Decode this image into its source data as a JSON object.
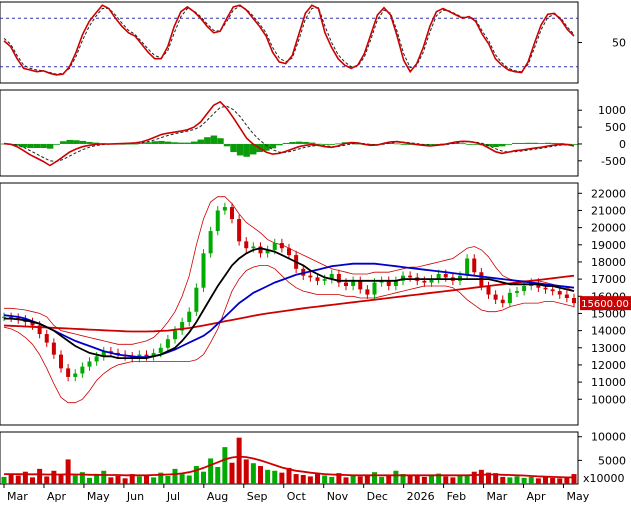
{
  "chart_data": [
    {
      "type": "line",
      "panel": "oscillator",
      "y_ticks": [
        {
          "value": 50,
          "label": "50"
        }
      ],
      "ylim": [
        0,
        100
      ],
      "ref_lines": [
        80,
        20
      ],
      "colors": {
        "main": "#cc0000",
        "signal": "#222222",
        "ref": "#3333aa"
      },
      "main": [
        52,
        45,
        30,
        18,
        16,
        14,
        15,
        12,
        10,
        11,
        20,
        38,
        60,
        76,
        86,
        96,
        92,
        80,
        70,
        62,
        58,
        48,
        38,
        30,
        30,
        45,
        70,
        88,
        94,
        88,
        80,
        70,
        62,
        64,
        80,
        94,
        96,
        90,
        80,
        70,
        58,
        38,
        26,
        24,
        34,
        60,
        86,
        96,
        92,
        62,
        44,
        30,
        22,
        18,
        22,
        36,
        60,
        84,
        93,
        84,
        58,
        28,
        14,
        24,
        44,
        70,
        88,
        92,
        88,
        84,
        80,
        82,
        76,
        60,
        48,
        30,
        22,
        16,
        14,
        13,
        26,
        50,
        72,
        85,
        86,
        78,
        66,
        58
      ],
      "signal": [
        55,
        48,
        34,
        22,
        18,
        16,
        15,
        13,
        11,
        12,
        18,
        33,
        53,
        70,
        82,
        92,
        92,
        84,
        74,
        65,
        60,
        51,
        42,
        34,
        31,
        40,
        62,
        82,
        92,
        89,
        82,
        73,
        65,
        64,
        76,
        90,
        95,
        91,
        83,
        73,
        62,
        44,
        31,
        26,
        31,
        53,
        79,
        92,
        93,
        70,
        50,
        35,
        26,
        20,
        21,
        32,
        54,
        78,
        90,
        86,
        64,
        36,
        19,
        22,
        38,
        63,
        83,
        90,
        89,
        85,
        81,
        82,
        78,
        64,
        52,
        35,
        25,
        18,
        15,
        14,
        23,
        44,
        66,
        81,
        85,
        80,
        69,
        60
      ]
    },
    {
      "type": "line",
      "panel": "macd",
      "y_ticks": [
        {
          "value": 1000,
          "label": "1000"
        },
        {
          "value": 500,
          "label": "500"
        },
        {
          "value": 0,
          "label": "0"
        },
        {
          "value": -500,
          "label": "-500"
        }
      ],
      "ylim": [
        -950,
        1600
      ],
      "colors": {
        "main": "#cc0000",
        "signal": "#222222",
        "hist": "#0a9a0a"
      },
      "main": [
        10,
        -10,
        -80,
        -200,
        -320,
        -420,
        -520,
        -640,
        -520,
        -380,
        -240,
        -150,
        -80,
        -40,
        -10,
        0,
        0,
        5,
        10,
        20,
        30,
        60,
        120,
        200,
        280,
        320,
        350,
        380,
        420,
        500,
        650,
        900,
        1150,
        1250,
        1050,
        780,
        480,
        180,
        0,
        -120,
        -240,
        -300,
        -280,
        -220,
        -150,
        -80,
        -40,
        -20,
        -40,
        -80,
        -100,
        -60,
        10,
        40,
        30,
        -10,
        -40,
        -30,
        20,
        60,
        70,
        40,
        10,
        -20,
        -40,
        -60,
        -40,
        -20,
        20,
        60,
        80,
        70,
        40,
        -20,
        -120,
        -230,
        -280,
        -240,
        -200,
        -180,
        -150,
        -120,
        -100,
        -60,
        -30,
        -10,
        -20,
        -60
      ],
      "signal": [
        0,
        -5,
        -30,
        -100,
        -200,
        -300,
        -400,
        -500,
        -520,
        -460,
        -360,
        -260,
        -170,
        -100,
        -50,
        -20,
        -5,
        0,
        5,
        10,
        20,
        35,
        70,
        120,
        190,
        250,
        300,
        340,
        380,
        430,
        520,
        700,
        900,
        1080,
        1120,
        1020,
        820,
        560,
        310,
        120,
        -40,
        -170,
        -240,
        -250,
        -210,
        -150,
        -100,
        -60,
        -45,
        -55,
        -75,
        -75,
        -40,
        0,
        20,
        10,
        -15,
        -25,
        -5,
        30,
        55,
        55,
        35,
        10,
        -15,
        -35,
        -40,
        -30,
        -5,
        30,
        60,
        70,
        55,
        20,
        -50,
        -140,
        -210,
        -240,
        -230,
        -210,
        -185,
        -155,
        -125,
        -95,
        -60,
        -35,
        -25,
        -40
      ]
    },
    {
      "type": "candlestick",
      "panel": "price",
      "last_price_label": "15600.00",
      "y_ticks": [
        {
          "value": 22000,
          "label": "22000"
        },
        {
          "value": 21000,
          "label": "21000"
        },
        {
          "value": 20000,
          "label": "20000"
        },
        {
          "value": 19000,
          "label": "19000"
        },
        {
          "value": 18000,
          "label": "18000"
        },
        {
          "value": 17000,
          "label": "17000"
        },
        {
          "value": 16000,
          "label": "16000"
        },
        {
          "value": 15000,
          "label": "15000"
        },
        {
          "value": 14000,
          "label": "14000"
        },
        {
          "value": 13000,
          "label": "13000"
        },
        {
          "value": 12000,
          "label": "12000"
        },
        {
          "value": 11000,
          "label": "11000"
        },
        {
          "value": 10000,
          "label": "10000"
        }
      ],
      "ylim": [
        8500,
        22600
      ],
      "colors": {
        "up": "#00aa00",
        "down": "#cc0000",
        "ma_fast": "#000000",
        "ma_mid": "#0000cc",
        "ma_slow": "#cc0000",
        "band": "#cc0000",
        "price_tag": "#cc0000"
      },
      "close": [
        14800,
        14750,
        14650,
        14500,
        14300,
        13800,
        13300,
        12600,
        11800,
        11300,
        11500,
        11900,
        12200,
        12500,
        12800,
        12700,
        12600,
        12500,
        12400,
        12600,
        12500,
        12700,
        13000,
        13500,
        14000,
        14500,
        15100,
        16500,
        18500,
        19800,
        21000,
        21200,
        20500,
        19200,
        18800,
        18900,
        18500,
        18700,
        19100,
        18800,
        18400,
        17600,
        17200,
        17100,
        16900,
        17000,
        17300,
        16800,
        16600,
        16900,
        16400,
        16100,
        16800,
        16900,
        16600,
        16900,
        17200,
        17100,
        16900,
        16800,
        17000,
        17300,
        17100,
        16900,
        17200,
        18200,
        17400,
        16600,
        16100,
        15800,
        15600,
        16200,
        16300,
        16600,
        16800,
        16500,
        16400,
        16300,
        16100,
        15900,
        15600
      ],
      "band_upper": [
        15300,
        15300,
        15250,
        15200,
        15100,
        15000,
        14800,
        14300,
        14000,
        13900,
        13800,
        13700,
        13600,
        13500,
        13400,
        13300,
        13200,
        13200,
        13200,
        13300,
        13400,
        13600,
        14000,
        14500,
        15100,
        16000,
        17200,
        19000,
        20500,
        21500,
        21800,
        21800,
        21400,
        20800,
        20300,
        20000,
        19700,
        19300,
        19100,
        19000,
        18800,
        18600,
        18400,
        18200,
        18000,
        17800,
        17600,
        17500,
        17400,
        17300,
        17300,
        17300,
        17400,
        17400,
        17400,
        17500,
        17600,
        17700,
        17700,
        17800,
        17900,
        18000,
        18100,
        18200,
        18500,
        18800,
        18900,
        18700,
        18300,
        17700,
        17200,
        17000,
        16900,
        16900,
        16900,
        16900,
        16800,
        16700,
        16600,
        16500,
        16300
      ],
      "band_lower": [
        14200,
        14100,
        13900,
        13600,
        13200,
        12600,
        11800,
        10900,
        10100,
        9800,
        9800,
        10000,
        10500,
        11100,
        11500,
        11800,
        12000,
        12100,
        12200,
        12200,
        12200,
        12200,
        12200,
        12200,
        12200,
        12200,
        12200,
        12300,
        12600,
        13300,
        14100,
        15200,
        16300,
        17000,
        17500,
        17700,
        17800,
        17800,
        17600,
        17200,
        16800,
        16500,
        16300,
        16200,
        16100,
        16100,
        16100,
        16100,
        16000,
        16000,
        15900,
        15900,
        15900,
        16000,
        16100,
        16200,
        16300,
        16400,
        16500,
        16600,
        16600,
        16600,
        16600,
        16500,
        16200,
        15800,
        15500,
        15200,
        15100,
        15100,
        15200,
        15400,
        15500,
        15600,
        15600,
        15600,
        15700,
        15700,
        15600,
        15500,
        15400
      ],
      "ma_fast": [
        14700,
        14700,
        14650,
        14600,
        14500,
        14400,
        14200,
        14000,
        13700,
        13400,
        13100,
        12900,
        12700,
        12600,
        12500,
        12500,
        12400,
        12400,
        12400,
        12400,
        12400,
        12500,
        12600,
        12800,
        13000,
        13400,
        13900,
        14500,
        15200,
        15900,
        16600,
        17200,
        17800,
        18200,
        18500,
        18700,
        18800,
        18700,
        18600,
        18400,
        18200,
        18000,
        17800,
        17500,
        17300,
        17100,
        17000,
        16900,
        16900,
        16900,
        16900,
        16900,
        16900,
        16900,
        16900,
        16900,
        17000,
        17000,
        17000,
        17000,
        17000,
        17000,
        17000,
        17000,
        17000,
        17000,
        17000,
        17000,
        17000,
        16900,
        16800,
        16700,
        16700,
        16700,
        16700,
        16700,
        16600,
        16600,
        16500,
        16400,
        16300
      ],
      "ma_mid": [
        14900,
        14850,
        14800,
        14700,
        14550,
        14400,
        14200,
        14000,
        13800,
        13600,
        13400,
        13250,
        13100,
        12950,
        12800,
        12700,
        12600,
        12550,
        12500,
        12450,
        12450,
        12500,
        12600,
        12750,
        12900,
        13100,
        13300,
        13500,
        13700,
        14000,
        14400,
        14800,
        15200,
        15600,
        15900,
        16200,
        16400,
        16600,
        16800,
        16950,
        17100,
        17250,
        17350,
        17450,
        17550,
        17650,
        17750,
        17800,
        17850,
        17900,
        17900,
        17900,
        17900,
        17850,
        17800,
        17750,
        17700,
        17650,
        17600,
        17550,
        17500,
        17450,
        17400,
        17350,
        17300,
        17250,
        17200,
        17150,
        17100,
        17050,
        17000,
        16950,
        16900,
        16850,
        16800,
        16750,
        16700,
        16650,
        16600,
        16550,
        16500
      ],
      "ma_slow": [
        14300,
        14280,
        14260,
        14240,
        14220,
        14200,
        14180,
        14160,
        14140,
        14120,
        14100,
        14080,
        14060,
        14040,
        14020,
        14000,
        13980,
        13960,
        13950,
        13950,
        13950,
        13960,
        13980,
        14000,
        14050,
        14100,
        14150,
        14220,
        14300,
        14380,
        14460,
        14540,
        14620,
        14700,
        14780,
        14860,
        14940,
        15000,
        15060,
        15120,
        15180,
        15240,
        15300,
        15350,
        15400,
        15450,
        15500,
        15550,
        15600,
        15650,
        15700,
        15750,
        15800,
        15850,
        15900,
        15950,
        16000,
        16050,
        16100,
        16150,
        16200,
        16250,
        16300,
        16350,
        16400,
        16450,
        16500,
        16550,
        16600,
        16650,
        16700,
        16750,
        16800,
        16850,
        16900,
        16950,
        17000,
        17050,
        17100,
        17150,
        17200
      ]
    },
    {
      "type": "bar",
      "panel": "volume",
      "unit_label": "x10000",
      "y_ticks": [
        {
          "value": 10000,
          "label": "10000"
        },
        {
          "value": 5000,
          "label": "5000"
        }
      ],
      "ylim": [
        0,
        11000
      ],
      "colors": {
        "up": "#00aa00",
        "down": "#cc0000",
        "ma": "#cc0000"
      },
      "x_ticks": [
        "Mar",
        "Apr",
        "May",
        "Jun",
        "Jul",
        "Aug",
        "Sep",
        "Oct",
        "Nov",
        "Dec",
        "2026",
        "Feb",
        "Mar",
        "Apr",
        "May"
      ],
      "values": [
        1500,
        2200,
        1800,
        2600,
        1400,
        3200,
        1600,
        2800,
        2000,
        5200,
        1800,
        2500,
        1300,
        1900,
        2800,
        1400,
        1700,
        1200,
        2100,
        1600,
        1800,
        1400,
        2400,
        1700,
        3200,
        2100,
        1800,
        3800,
        2600,
        5400,
        3600,
        7800,
        4500,
        9800,
        5200,
        4400,
        3800,
        3000,
        2800,
        2400,
        3400,
        2100,
        1900,
        1600,
        2200,
        1800,
        1500,
        2300,
        1400,
        1900,
        1600,
        1700,
        2500,
        1500,
        1900,
        2800,
        2100,
        1800,
        2000,
        1500,
        1800,
        2200,
        1600,
        1400,
        1900,
        1700,
        2600,
        3000,
        2400,
        2300,
        1500,
        1400,
        1600,
        1300,
        1500,
        1200,
        1400,
        1300,
        1200,
        1500,
        2100
      ],
      "ma": [
        2100,
        2100,
        2100,
        2050,
        2050,
        2050,
        2000,
        2000,
        2000,
        2050,
        2000,
        2000,
        1950,
        1950,
        1900,
        1900,
        1900,
        1850,
        1850,
        1850,
        1850,
        1900,
        1950,
        2000,
        2100,
        2250,
        2500,
        2900,
        3400,
        4000,
        4600,
        5200,
        5600,
        5800,
        5700,
        5400,
        5000,
        4500,
        4000,
        3500,
        3100,
        2800,
        2600,
        2400,
        2250,
        2100,
        2000,
        1950,
        1900,
        1850,
        1850,
        1850,
        1850,
        1850,
        1850,
        1850,
        1850,
        1850,
        1850,
        1850,
        1850,
        1850,
        1850,
        1850,
        1850,
        1850,
        1900,
        1950,
        2000,
        2000,
        1950,
        1900,
        1850,
        1800,
        1700,
        1600,
        1550,
        1500,
        1450,
        1400,
        1400
      ]
    }
  ]
}
